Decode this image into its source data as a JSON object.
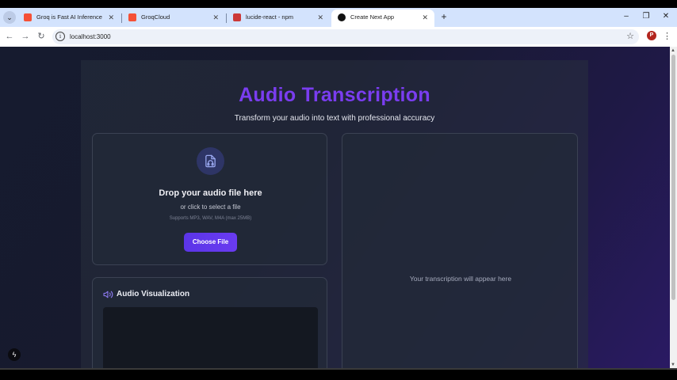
{
  "browser": {
    "tabs": [
      {
        "title": "Groq is Fast AI Inference",
        "favicon_color": "#f55036",
        "close": "✕"
      },
      {
        "title": "GroqCloud",
        "favicon_color": "#f55036",
        "close": "✕"
      },
      {
        "title": "lucide-react - npm",
        "favicon_color": "#cb3837",
        "close": "✕"
      },
      {
        "title": "Create Next App",
        "favicon_color": "#111111",
        "close": "✕"
      }
    ],
    "new_tab": "+",
    "tab_menu": "⌄",
    "window_controls": {
      "minimize": "–",
      "restore": "❐",
      "close": "✕"
    },
    "nav": {
      "back": "←",
      "forward": "→",
      "reload": "↻"
    },
    "url": "localhost:3000",
    "info_icon": "i",
    "bookmark_icon": "☆",
    "profile_initial": "P",
    "menu_icon": "⋮"
  },
  "page": {
    "title": "Audio Transcription",
    "subtitle": "Transform your audio into text with professional accuracy",
    "upload": {
      "heading": "Drop your audio file here",
      "subtext": "or click to select a file",
      "hint": "Supports MP3, WAV, M4A (max 25MB)",
      "button": "Choose File"
    },
    "visualization": {
      "title": "Audio Visualization"
    },
    "transcription": {
      "placeholder": "Your transcription will appear here"
    },
    "dev_indicator": "ϟ"
  },
  "colors": {
    "accent": "#7a3df0",
    "button": "#5b35e8",
    "background": "#161b2f"
  }
}
